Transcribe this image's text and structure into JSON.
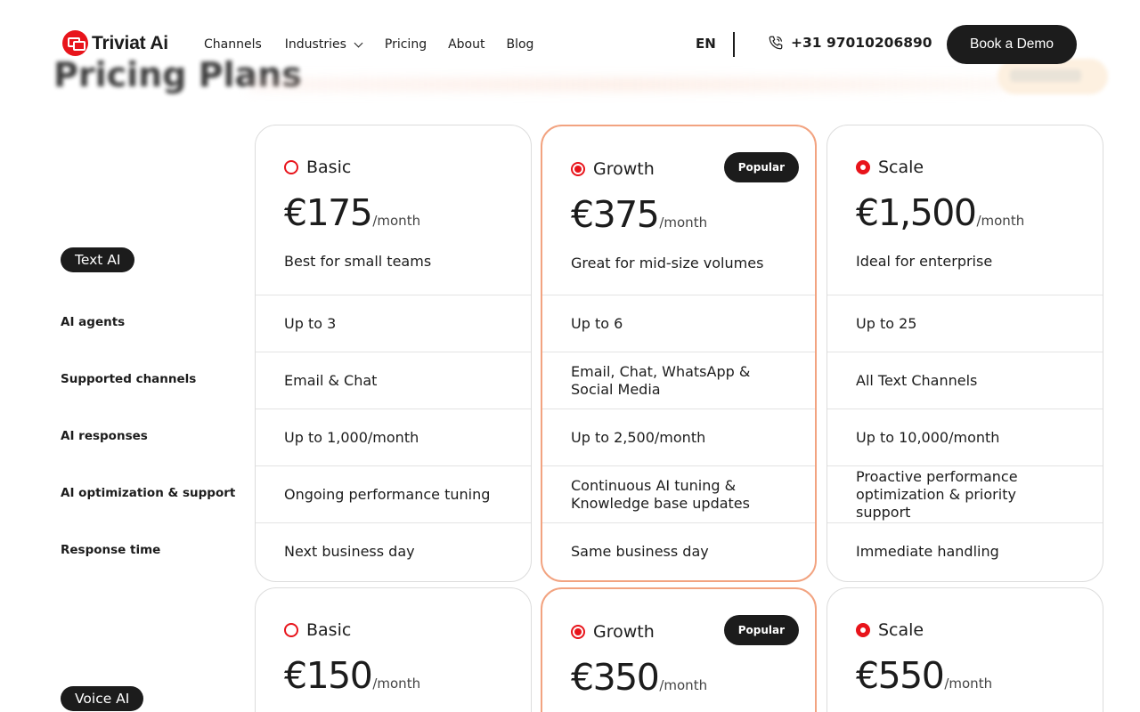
{
  "header": {
    "brand": "Triviat Ai",
    "nav": [
      "Channels",
      "Industries",
      "Pricing",
      "About",
      "Blog"
    ],
    "language": "EN",
    "phone": "+31 97010206890",
    "cta": "Book a Demo"
  },
  "background": {
    "title": "Pricing Plans"
  },
  "sections": {
    "text_ai": "Text AI",
    "voice_ai": "Voice AI"
  },
  "row_labels": [
    "AI agents",
    "Supported channels",
    "AI responses",
    "AI optimization & support",
    "Response time"
  ],
  "text_plans": [
    {
      "name": "Basic",
      "price": "€175",
      "period": "/month",
      "tagline": "Best for small teams",
      "badge": "",
      "rows": [
        "Up to 3",
        "Email & Chat",
        "Up to 1,000/month",
        "Ongoing performance tuning",
        "Next business day"
      ]
    },
    {
      "name": "Growth",
      "price": "€375",
      "period": "/month",
      "tagline": "Great for mid-size volumes",
      "badge": "Popular",
      "rows": [
        "Up to 6",
        "Email, Chat, WhatsApp & Social Media",
        "Up to 2,500/month",
        "Continuous AI tuning & Knowledge base updates",
        "Same business day"
      ]
    },
    {
      "name": "Scale",
      "price": "€1,500",
      "period": "/month",
      "tagline": "Ideal for enterprise",
      "badge": "",
      "rows": [
        "Up to 25",
        "All Text Channels",
        "Up to 10,000/month",
        "Proactive performance optimization & priority support",
        "Immediate handling"
      ]
    }
  ],
  "voice_plans": [
    {
      "name": "Basic",
      "price": "€150",
      "period": "/month",
      "badge": ""
    },
    {
      "name": "Growth",
      "price": "€350",
      "period": "/month",
      "badge": "Popular"
    },
    {
      "name": "Scale",
      "price": "€550",
      "period": "/month",
      "badge": ""
    }
  ],
  "colors": {
    "accent": "#e8141b",
    "popular_border": "#f2a380",
    "dark": "#1c1c1c"
  }
}
